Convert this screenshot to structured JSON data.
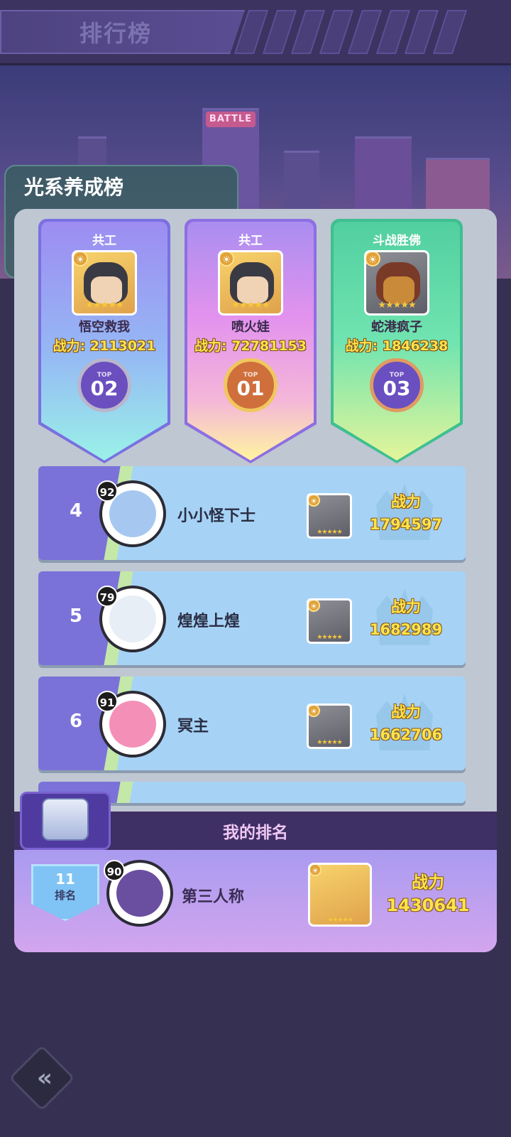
{
  "header": {
    "title": "排行榜"
  },
  "scene": {
    "sign": "BATTLE"
  },
  "section": {
    "title": "光系养成榜"
  },
  "podium": [
    {
      "place": 2,
      "guild": "共工",
      "name": "悟空救我",
      "power_label": "战力:",
      "power": "2113021",
      "medal_top": "TOP",
      "medal_num": "02"
    },
    {
      "place": 1,
      "guild": "共工",
      "name": "喷火娃",
      "power_label": "战力:",
      "power": "72781153",
      "medal_top": "TOP",
      "medal_num": "01"
    },
    {
      "place": 3,
      "guild": "斗战胜佛",
      "name": "蛇港疯子",
      "power_label": "战力:",
      "power": "1846238",
      "medal_top": "TOP",
      "medal_num": "03"
    }
  ],
  "rows": [
    {
      "rank": "4",
      "level": "92",
      "name": "小小怪下士",
      "power_label": "战力",
      "power": "1794597"
    },
    {
      "rank": "5",
      "level": "79",
      "name": "煌煌上煌",
      "power_label": "战力",
      "power": "1682989"
    },
    {
      "rank": "6",
      "level": "91",
      "name": "冥主",
      "power_label": "战力",
      "power": "1662706"
    }
  ],
  "my_rank": {
    "header": "我的排名",
    "rank": "11",
    "rank_label": "排名",
    "level": "90",
    "name": "第三人称",
    "power_label": "战力",
    "power": "1430641"
  },
  "icons": {
    "stars": "★★★★★",
    "sun": "☀",
    "back": "«"
  },
  "colors": {
    "accent_gold": "#ffe44a",
    "row_bg": "#a6d3f5",
    "panel_bg": "#bfc7d3"
  }
}
